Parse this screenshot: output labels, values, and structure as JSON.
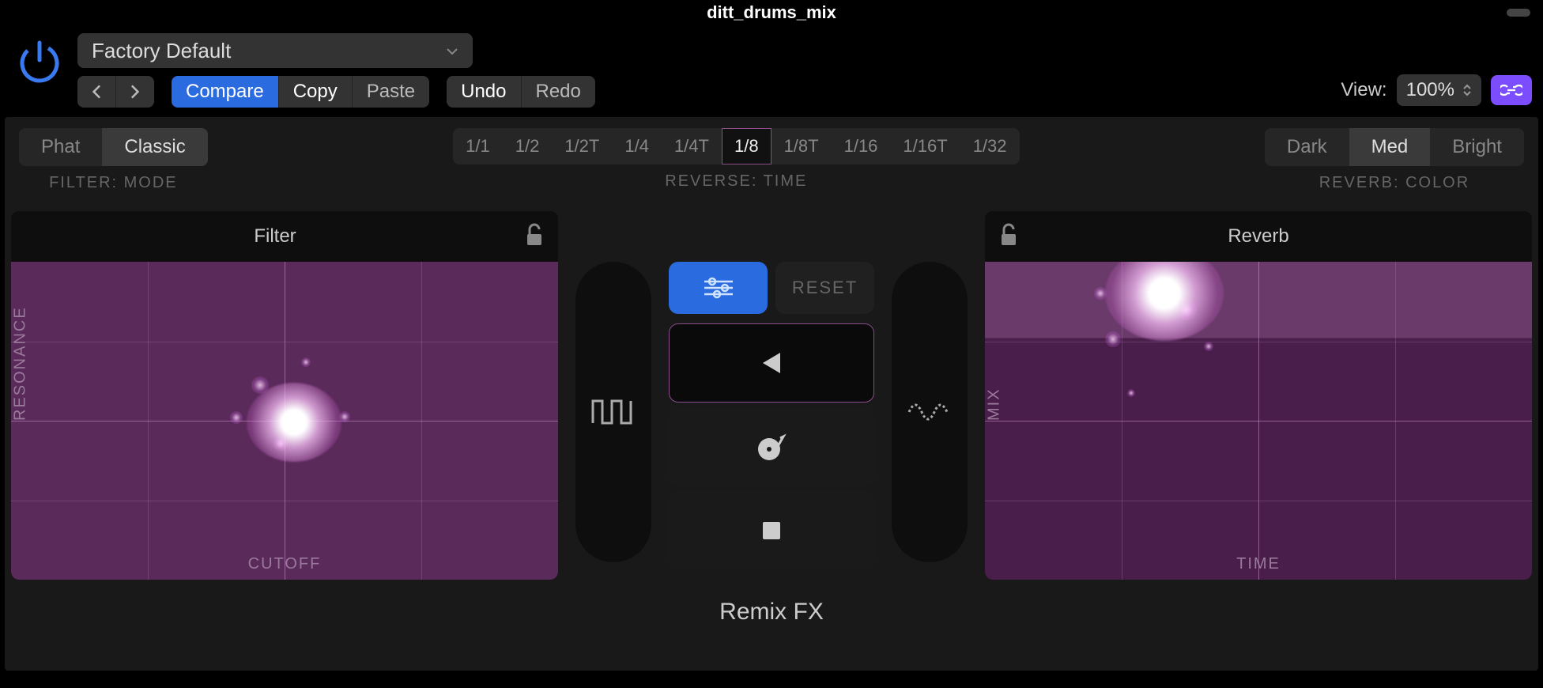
{
  "window": {
    "title": "ditt_drums_mix"
  },
  "toolbar": {
    "preset": "Factory Default",
    "compare": "Compare",
    "copy": "Copy",
    "paste": "Paste",
    "undo": "Undo",
    "redo": "Redo",
    "view_label": "View:",
    "zoom": "100%"
  },
  "filter_mode": {
    "label": "FILTER: MODE",
    "options": [
      "Phat",
      "Classic"
    ],
    "active": 1
  },
  "reverse_time": {
    "label": "REVERSE: TIME",
    "options": [
      "1/1",
      "1/2",
      "1/2T",
      "1/4",
      "1/4T",
      "1/8",
      "1/8T",
      "1/16",
      "1/16T",
      "1/32"
    ],
    "active": 5
  },
  "reverb_color": {
    "label": "REVERB: COLOR",
    "options": [
      "Dark",
      "Med",
      "Bright"
    ],
    "active": 1
  },
  "filter_pad": {
    "title": "Filter",
    "x_label": "CUTOFF",
    "y_label": "RESONANCE"
  },
  "reverb_pad": {
    "title": "Reverb",
    "x_label": "TIME",
    "y_label": "MIX"
  },
  "center": {
    "reset": "RESET"
  },
  "footer": "Remix FX"
}
